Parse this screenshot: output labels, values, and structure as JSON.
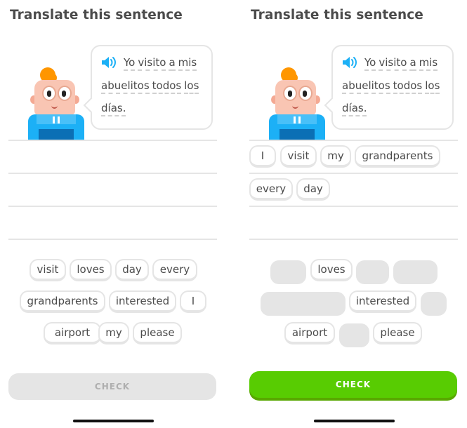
{
  "panels": [
    {
      "title": "Translate this sentence",
      "sentence": {
        "line1": [
          "Yo",
          "visito",
          "a",
          "mis"
        ],
        "line2": [
          "abuelitos",
          "todos",
          "los"
        ],
        "line3": [
          "días."
        ]
      },
      "answer_chips": [],
      "word_bank": [
        "visit",
        "loves",
        "day",
        "every",
        "grandparents",
        "interested",
        "I",
        "airport",
        "my",
        "please"
      ],
      "check_label": "CHECK",
      "check_state": "disabled"
    },
    {
      "title": "Translate this sentence",
      "sentence": {
        "line1": [
          "Yo",
          "visito",
          "a",
          "mis"
        ],
        "line2": [
          "abuelitos",
          "todos",
          "los"
        ],
        "line3": [
          "días."
        ]
      },
      "answer_chips": [
        "I",
        "visit",
        "my",
        "grandparents",
        "every",
        "day"
      ],
      "word_bank_remaining": [
        "loves",
        "interested",
        "airport",
        "please"
      ],
      "check_label": "CHECK",
      "check_state": "active"
    }
  ],
  "icons": {
    "speaker": "speaker-icon"
  },
  "colors": {
    "accent_green": "#58cc02",
    "speaker_blue": "#1cb0f6",
    "disabled": "#e5e5e5"
  }
}
